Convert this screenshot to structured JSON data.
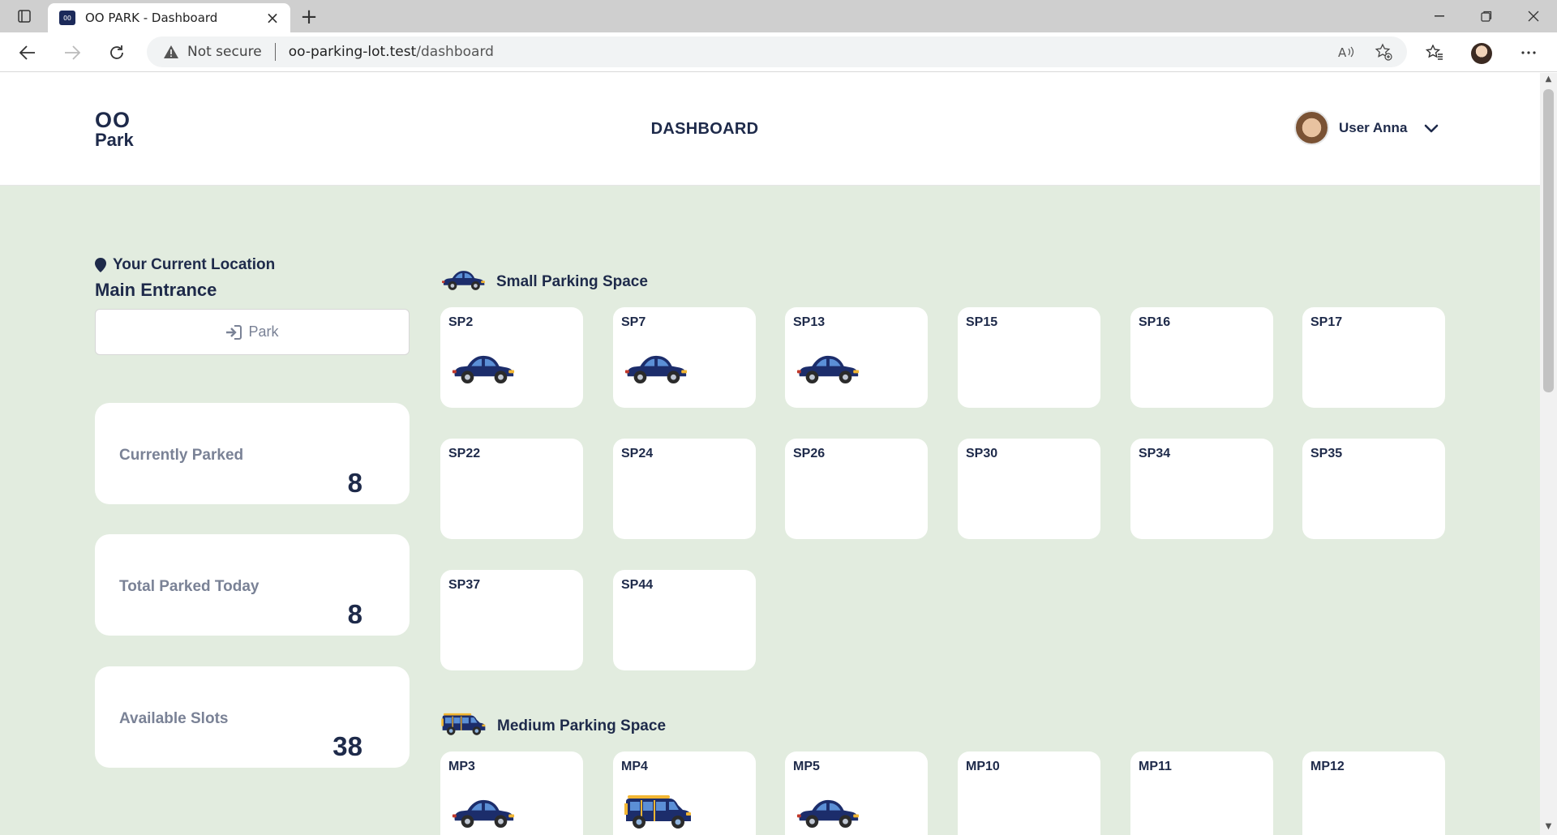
{
  "browser": {
    "tab_title": "OO PARK - Dashboard",
    "favicon_text": "OO",
    "security_label": "Not secure",
    "url_host": "oo-parking-lot.test",
    "url_path": "/dashboard",
    "icons": {
      "sidebar_toggle": "tab-actions-icon",
      "close_tab": "close-icon",
      "new_tab": "plus-icon",
      "minimize": "minimize-icon",
      "restore": "restore-icon",
      "close_window": "close-icon",
      "back": "arrow-left-icon",
      "forward": "arrow-right-icon",
      "reload": "reload-icon",
      "warning": "warning-triangle-icon",
      "read_aloud": "read-aloud-icon",
      "add_favorite": "star-plus-icon",
      "favorites": "favorites-icon",
      "profile": "profile-avatar",
      "more": "more-dots-icon"
    }
  },
  "header": {
    "logo_line1": "OO",
    "logo_line2": "Park",
    "title": "DASHBOARD",
    "user_name": "User Anna"
  },
  "location": {
    "label": "Your Current Location",
    "value": "Main Entrance",
    "park_button": "Park"
  },
  "stats": [
    {
      "label": "Currently Parked",
      "value": "8"
    },
    {
      "label": "Total Parked Today",
      "value": "8"
    },
    {
      "label": "Available Slots",
      "value": "38"
    }
  ],
  "sections": [
    {
      "title": "Small Parking Space",
      "icon": "small-car-icon",
      "slots": [
        {
          "id": "SP2",
          "vehicle": "small-car"
        },
        {
          "id": "SP7",
          "vehicle": "small-car"
        },
        {
          "id": "SP13",
          "vehicle": "small-car"
        },
        {
          "id": "SP15",
          "vehicle": ""
        },
        {
          "id": "SP16",
          "vehicle": ""
        },
        {
          "id": "SP17",
          "vehicle": ""
        },
        {
          "id": "SP22",
          "vehicle": ""
        },
        {
          "id": "SP24",
          "vehicle": ""
        },
        {
          "id": "SP26",
          "vehicle": ""
        },
        {
          "id": "SP30",
          "vehicle": ""
        },
        {
          "id": "SP34",
          "vehicle": ""
        },
        {
          "id": "SP35",
          "vehicle": ""
        },
        {
          "id": "SP37",
          "vehicle": ""
        },
        {
          "id": "SP44",
          "vehicle": ""
        }
      ]
    },
    {
      "title": "Medium Parking Space",
      "icon": "medium-car-icon",
      "slots": [
        {
          "id": "MP3",
          "vehicle": "small-car"
        },
        {
          "id": "MP4",
          "vehicle": "medium-car"
        },
        {
          "id": "MP5",
          "vehicle": "small-car"
        },
        {
          "id": "MP10",
          "vehicle": ""
        },
        {
          "id": "MP11",
          "vehicle": ""
        },
        {
          "id": "MP12",
          "vehicle": ""
        }
      ]
    }
  ],
  "colors": {
    "page_bg": "#e2ecdf",
    "navy": "#1e2a4a",
    "car_body": "#1c2d6b",
    "car_window": "#5b8fd6",
    "car_light": "#f2b632",
    "muted_text": "#7a8296"
  }
}
